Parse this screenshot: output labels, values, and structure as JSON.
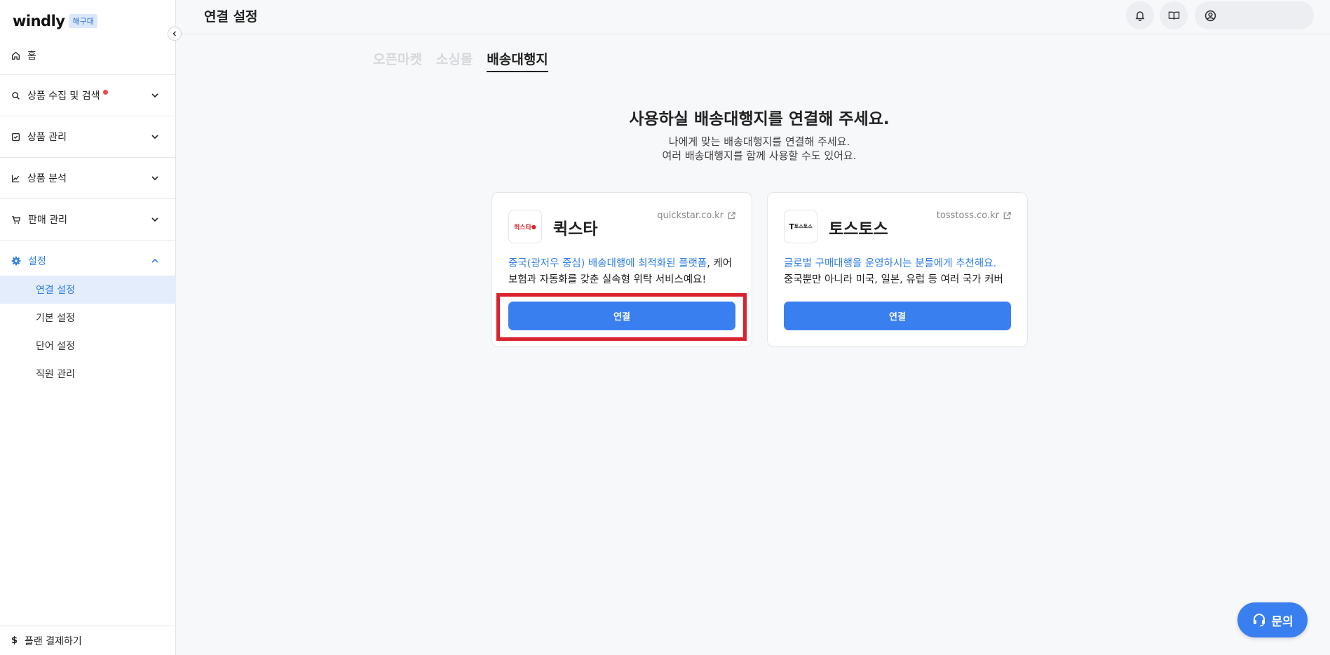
{
  "app": {
    "logo": "windly",
    "badge": "해구대"
  },
  "sidebar": {
    "home": "홈",
    "groups": [
      {
        "label": "상품 수집 및 검색"
      },
      {
        "label": "상품 관리"
      },
      {
        "label": "상품 분석"
      },
      {
        "label": "판매 관리"
      },
      {
        "label": "설정"
      }
    ],
    "sub_items": [
      {
        "label": "연결 설정"
      },
      {
        "label": "기본 설정"
      },
      {
        "label": "단어 설정"
      },
      {
        "label": "직원 관리"
      }
    ],
    "plan": "플랜 결제하기"
  },
  "header": {
    "title": "연결 설정"
  },
  "tabs": [
    {
      "label": "오픈마켓"
    },
    {
      "label": "소싱몰"
    },
    {
      "label": "배송대행지"
    }
  ],
  "main": {
    "heading": "사용하실 배송대행지를 연결해 주세요.",
    "sub1": "나에게 맞는 배송대행지를 연결해 주세요.",
    "sub2": "여러 배송대행지를 함께 사용할 수도 있어요."
  },
  "cards": [
    {
      "logo_text": "퀵스타",
      "name": "퀵스타",
      "link": "quickstar.co.kr",
      "desc_highlight": "중국(광저우 중심) 배송대행에 최적화된 플랫폼",
      "desc_rest": ", 케어보험과 자동화를 갖춘 실속형 위탁 서비스예요!",
      "button": "연결"
    },
    {
      "logo_text": "토스토스",
      "name": "토스토스",
      "link": "tosstoss.co.kr",
      "desc_highlight": "글로벌 구매대행을 운영하시는 분들에게 추천해요.",
      "desc_rest": "중국뿐만 아니라 미국, 일본, 유럽 등 여러 국가 커버",
      "button": "연결"
    }
  ],
  "fab": {
    "label": "문의"
  },
  "colors": {
    "accent": "#3a7ff0",
    "highlight_box": "#d9232e"
  }
}
